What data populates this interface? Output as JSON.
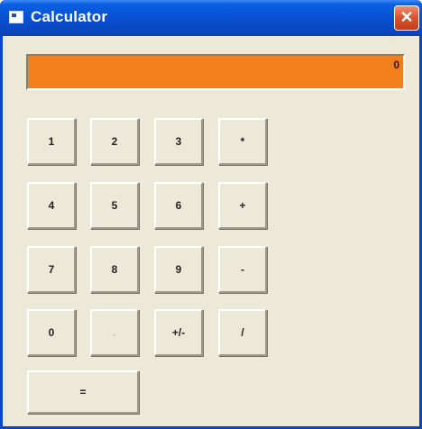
{
  "window": {
    "title": "Calculator",
    "close_glyph": "✕"
  },
  "display": {
    "value": "0"
  },
  "keypad": {
    "k1": "1",
    "k2": "2",
    "k3": "3",
    "k_mul": "*",
    "k4": "4",
    "k5": "5",
    "k6": "6",
    "k_add": "+",
    "k7": "7",
    "k8": "8",
    "k9": "9",
    "k_sub": "-",
    "k0": "0",
    "k_dot": ".",
    "k_sign": "+/-",
    "k_div": "/",
    "k_eq": "="
  },
  "colors": {
    "display_bg": "#f07f1c",
    "title_bar": "#0a4fd0",
    "close_button": "#d8532e",
    "window_bg": "#ece9d8"
  },
  "icons": {
    "app": "calculator-app-icon",
    "close": "close-icon"
  }
}
